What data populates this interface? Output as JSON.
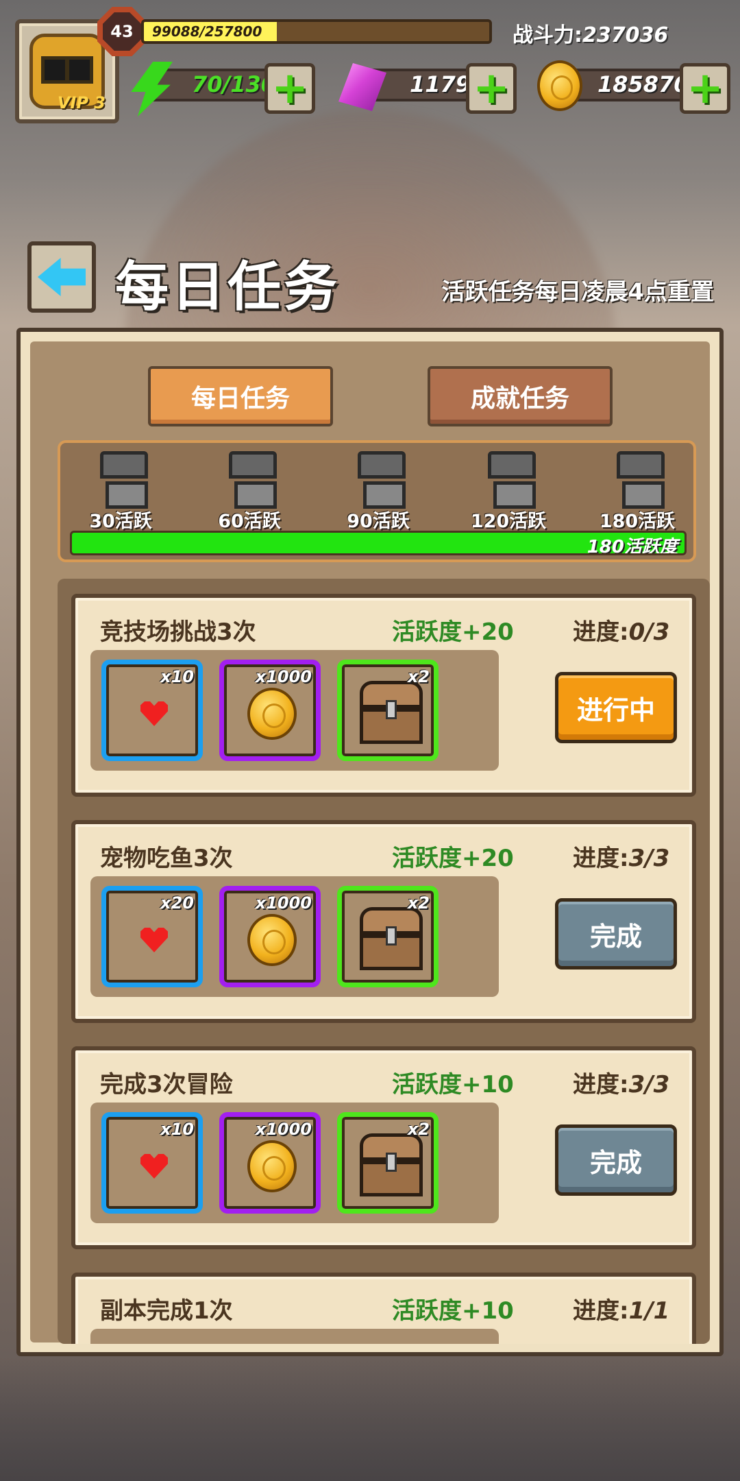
{
  "player": {
    "level": "43",
    "vip": "VIP 3",
    "xp_text": "99088/257800",
    "xp_fraction": 0.384,
    "power_label": "战斗力:",
    "power_value": "237036"
  },
  "resources": {
    "energy": "70/130",
    "gems": "1179",
    "gold": "185870"
  },
  "header": {
    "title": "每日任务",
    "reset_note": "活跃任务每日凌晨4点重置"
  },
  "tabs": [
    {
      "label": "每日任务"
    },
    {
      "label": "成就任务"
    }
  ],
  "milestones": [
    {
      "label": "30活跃"
    },
    {
      "label": "60活跃"
    },
    {
      "label": "90活跃"
    },
    {
      "label": "120活跃"
    },
    {
      "label": "180活跃"
    }
  ],
  "activity": {
    "text": "180活跃度",
    "fraction": 1.0
  },
  "tasks": [
    {
      "name": "竞技场挑战3次",
      "points": "活跃度+20",
      "progress_label": "进度:",
      "progress_value": "0/3",
      "rewards": {
        "hearts": "x10",
        "gold": "x1000",
        "chest": "x2"
      },
      "status": "进行中"
    },
    {
      "name": "宠物吃鱼3次",
      "points": "活跃度+20",
      "progress_label": "进度:",
      "progress_value": "3/3",
      "rewards": {
        "hearts": "x20",
        "gold": "x1000",
        "chest": "x2"
      },
      "status": "完成"
    },
    {
      "name": "完成3次冒险",
      "points": "活跃度+10",
      "progress_label": "进度:",
      "progress_value": "3/3",
      "rewards": {
        "hearts": "x10",
        "gold": "x1000",
        "chest": "x2"
      },
      "status": "完成"
    },
    {
      "name": "副本完成1次",
      "points": "活跃度+10",
      "progress_label": "进度:",
      "progress_value": "1/1"
    }
  ],
  "colors": {
    "in_progress": "#f49a12",
    "done": "#6f8794",
    "points_green": "#2e8a24",
    "activity_fill": "#22e410"
  }
}
